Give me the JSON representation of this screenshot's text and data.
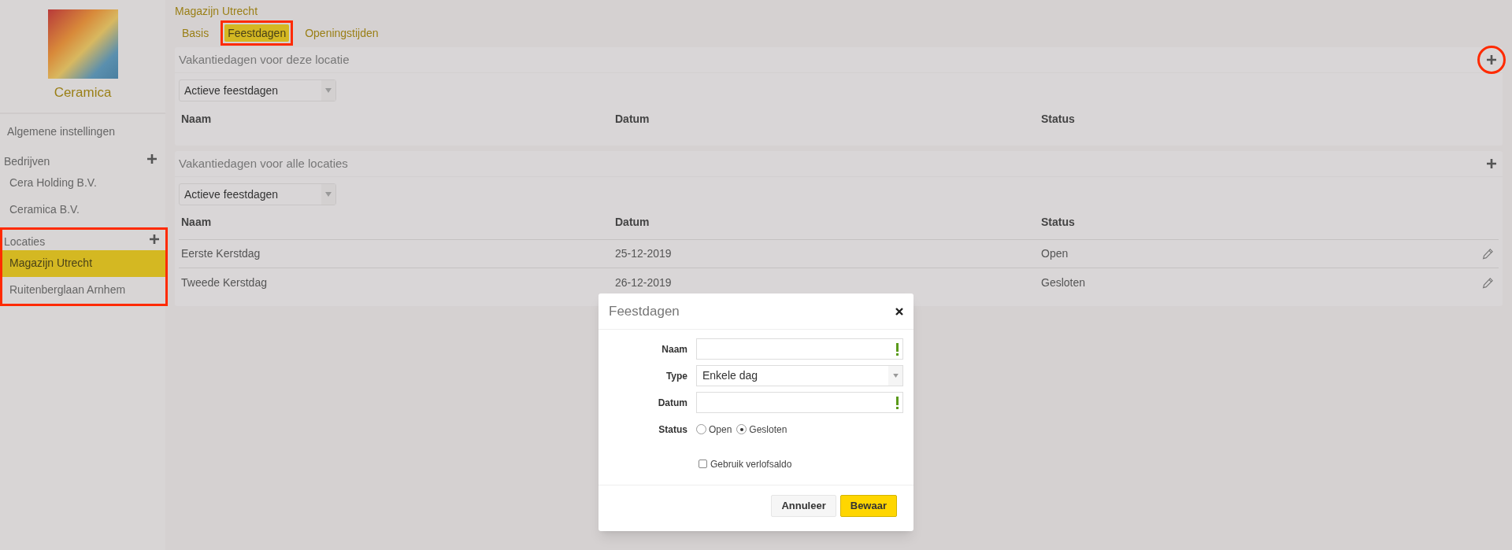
{
  "sidebar": {
    "company": "Ceramica",
    "items": [
      {
        "label": "Algemene instellingen",
        "selected": false
      }
    ],
    "groups": [
      {
        "title": "Bedrijven",
        "items": [
          {
            "label": "Cera Holding B.V.",
            "selected": false
          },
          {
            "label": "Ceramica B.V.",
            "selected": false
          }
        ]
      },
      {
        "title": "Locaties",
        "highlighted": true,
        "items": [
          {
            "label": "Magazijn Utrecht",
            "selected": true
          },
          {
            "label": "Ruitenberglaan Arnhem",
            "selected": false
          }
        ]
      }
    ]
  },
  "page_title": "Magazijn Utrecht",
  "tabs": [
    {
      "label": "Basis",
      "selected": false,
      "highlighted": false
    },
    {
      "label": "Feestdagen",
      "selected": true,
      "highlighted": true
    },
    {
      "label": "Openingstijden",
      "selected": false,
      "highlighted": false
    }
  ],
  "sections": [
    {
      "title": "Vakantiedagen voor deze locatie",
      "add_highlighted": true,
      "filter": "Actieve feestdagen",
      "columns": [
        "Naam",
        "Datum",
        "Status"
      ]
    },
    {
      "title": "Vakantiedagen voor alle locaties",
      "add_highlighted": false,
      "filter": "Actieve feestdagen",
      "columns": [
        "Naam",
        "Datum",
        "Status"
      ],
      "rows": [
        {
          "naam": "Eerste Kerstdag",
          "datum": "25-12-2019",
          "status": "Open"
        },
        {
          "naam": "Tweede Kerstdag",
          "datum": "26-12-2019",
          "status": "Gesloten"
        }
      ]
    }
  ],
  "dialog": {
    "title": "Feestdagen",
    "fields": [
      {
        "kind": "text",
        "label": "Naam",
        "required": true
      },
      {
        "kind": "select",
        "label": "Type",
        "value": "Enkele dag"
      },
      {
        "kind": "text",
        "label": "Datum",
        "required": true
      },
      {
        "kind": "radio",
        "label": "Status",
        "options": [
          {
            "label": "Open",
            "selected": false
          },
          {
            "label": "Gesloten",
            "selected": true
          }
        ]
      },
      {
        "kind": "checkbox",
        "label": "Gebruik verlofsaldo",
        "checked": false
      }
    ],
    "buttons": [
      {
        "label": "Annuleer",
        "kind": "secondary"
      },
      {
        "label": "Bewaar",
        "kind": "primary"
      }
    ]
  }
}
